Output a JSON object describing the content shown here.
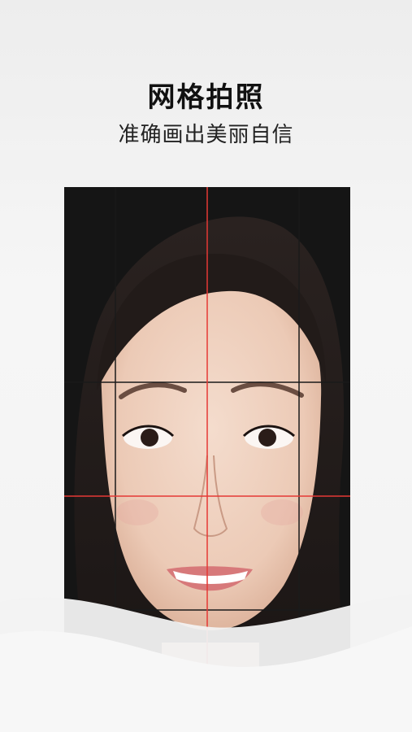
{
  "header": {
    "title": "网格拍照",
    "subtitle": "准确画出美丽自信"
  },
  "photo": {
    "subject": "portrait-face",
    "grid_color": "#1a1a1a",
    "guide_color": "#e53935"
  }
}
